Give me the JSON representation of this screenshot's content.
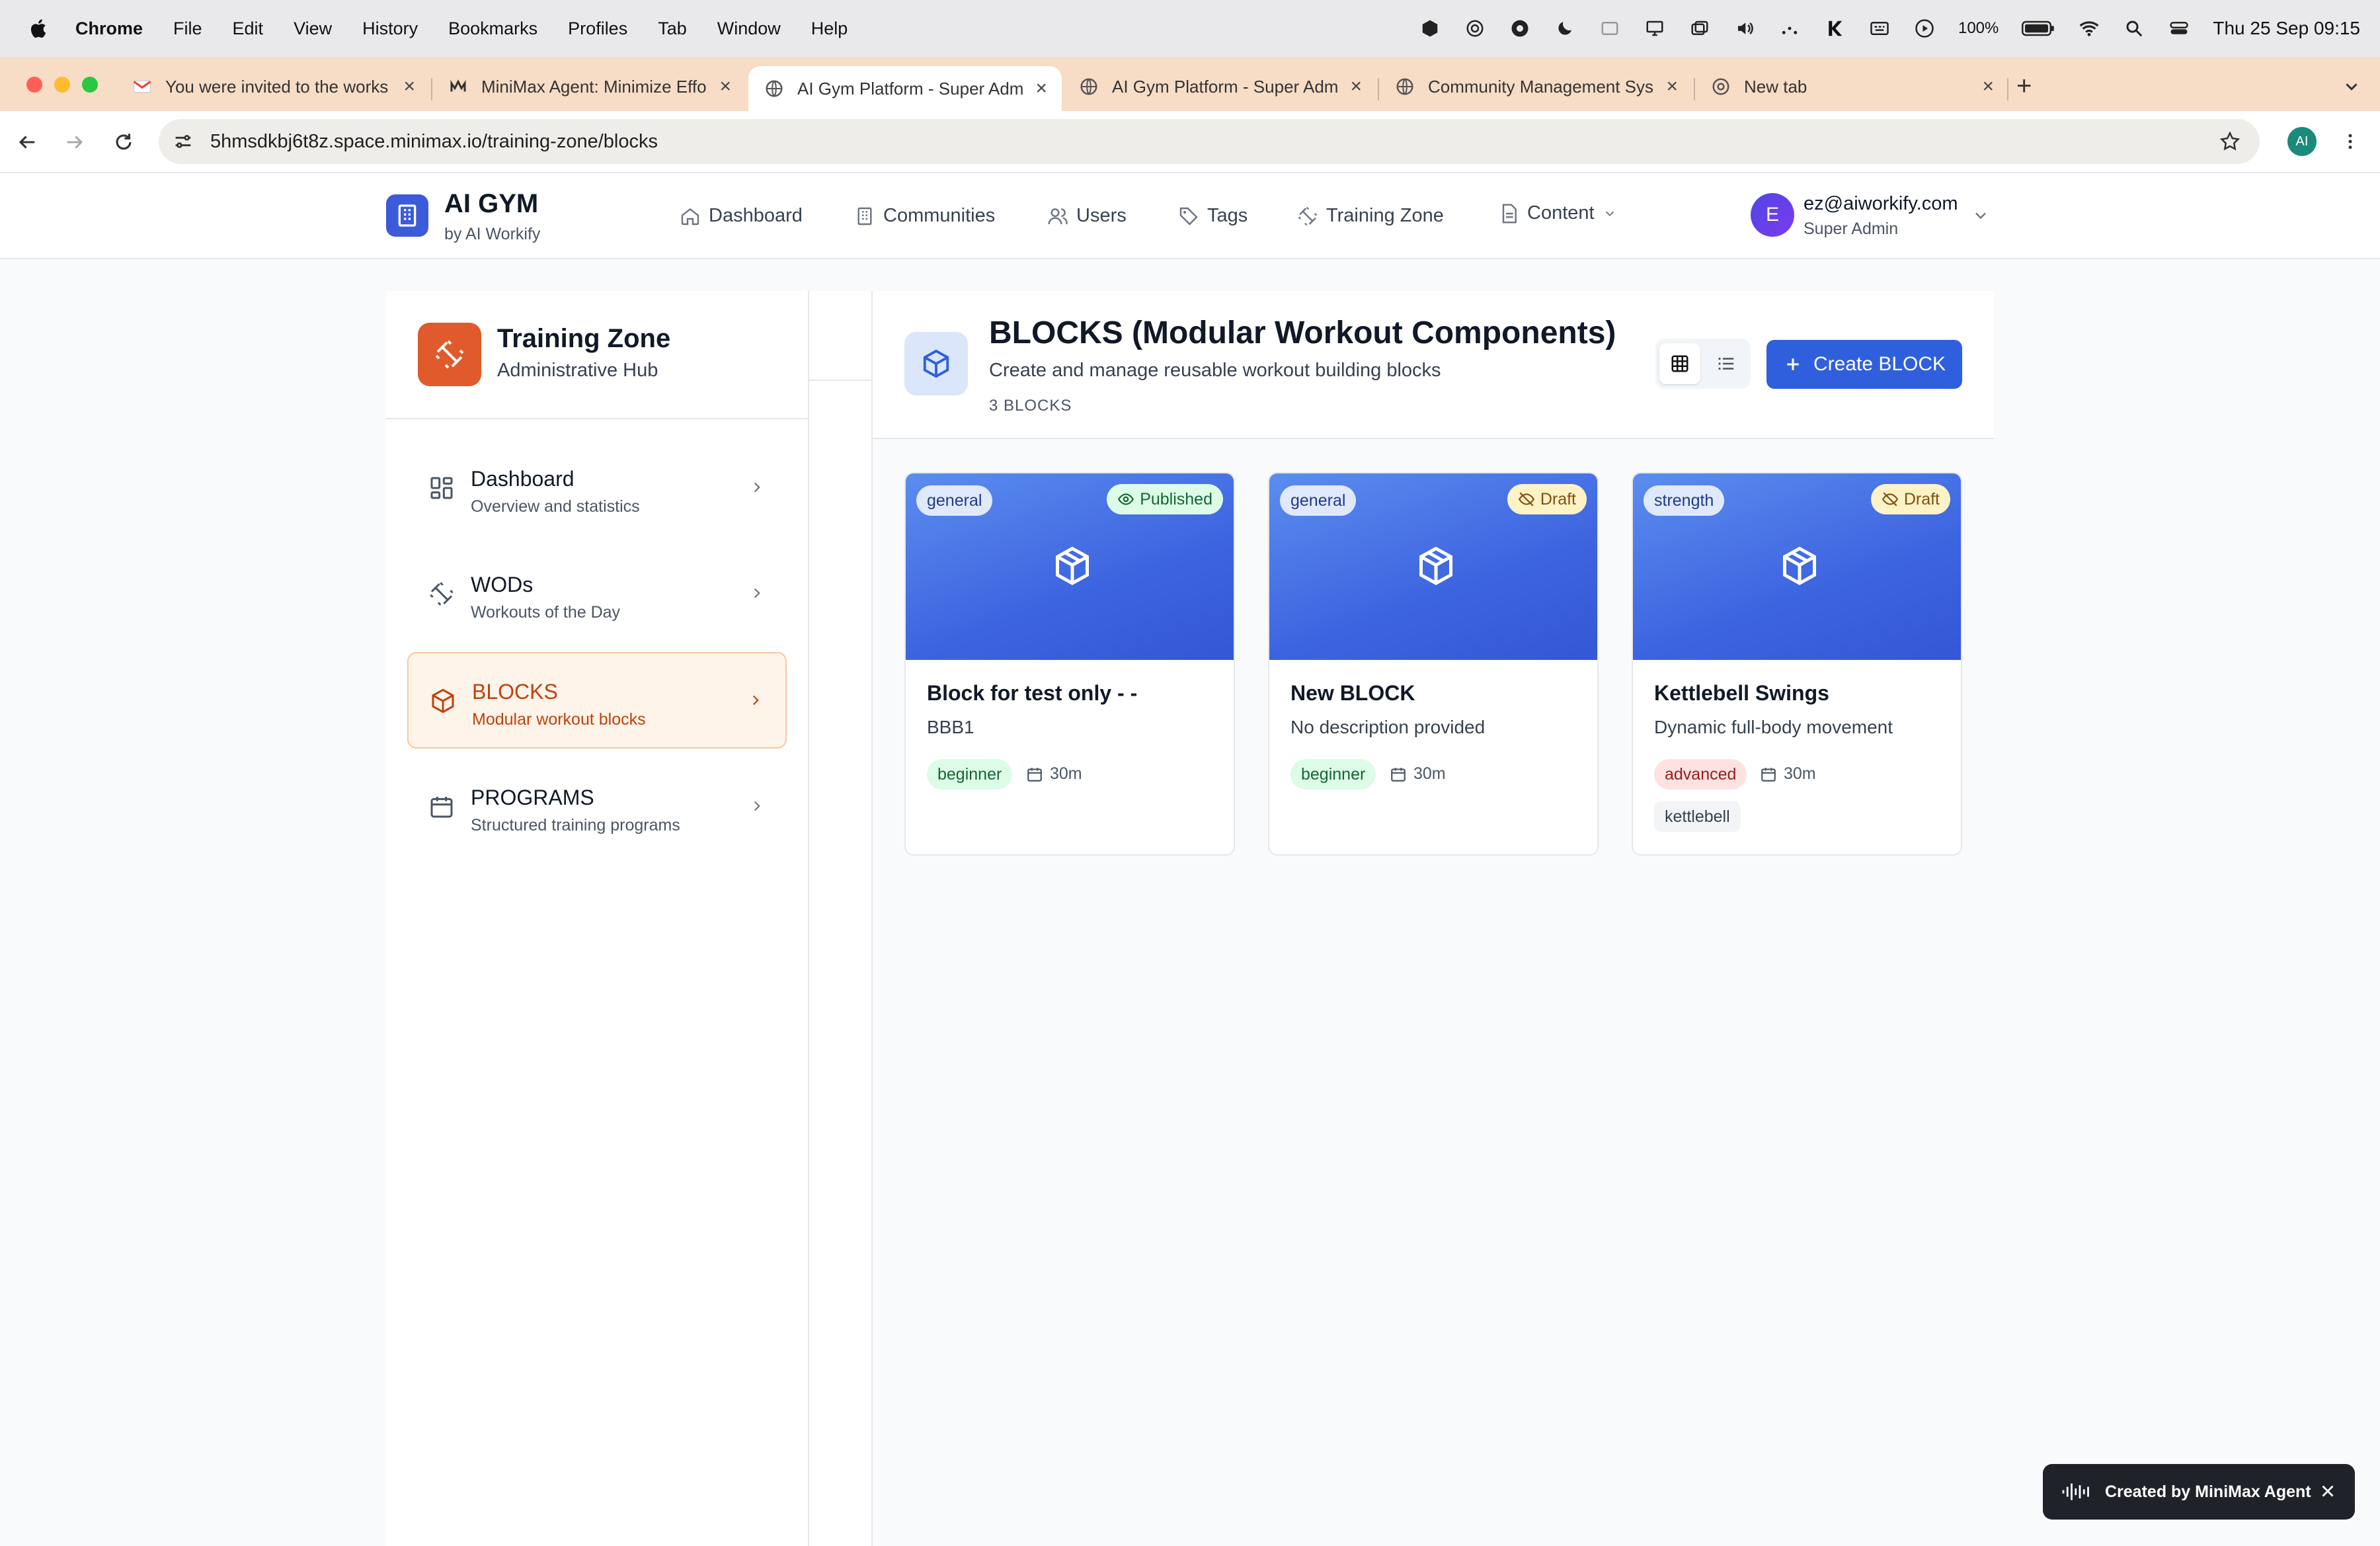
{
  "menubar": {
    "app": "Chrome",
    "items": [
      "File",
      "Edit",
      "View",
      "History",
      "Bookmarks",
      "Profiles",
      "Tab",
      "Window",
      "Help"
    ],
    "battery": "100%",
    "clock": "Thu 25 Sep  09:15"
  },
  "tabs": [
    {
      "title": "You were invited to the works",
      "icon": "gmail-icon"
    },
    {
      "title": "MiniMax Agent: Minimize Effo",
      "icon": "minimax-icon"
    },
    {
      "title": "AI Gym Platform - Super Adm",
      "icon": "globe-icon",
      "active": true
    },
    {
      "title": "AI Gym Platform - Super Adm",
      "icon": "globe-icon"
    },
    {
      "title": "Community Management Sys",
      "icon": "globe-icon"
    },
    {
      "title": "New tab",
      "icon": "chrome-icon"
    }
  ],
  "address": {
    "url": "5hmsdkbj6t8z.space.minimax.io/training-zone/blocks",
    "profile_initials": "AI"
  },
  "header": {
    "logo_title": "AI GYM",
    "logo_sub": "by AI Workify",
    "nav": [
      {
        "label": "Dashboard",
        "icon": "home-icon"
      },
      {
        "label": "Communities",
        "icon": "building-icon"
      },
      {
        "label": "Users",
        "icon": "users-icon"
      },
      {
        "label": "Tags",
        "icon": "tag-icon"
      },
      {
        "label": "Training Zone",
        "icon": "dumbbell-icon"
      },
      {
        "label": "Content",
        "icon": "document-icon"
      }
    ],
    "user_initial": "E",
    "user_email": "ez@aiworkify.com",
    "user_role": "Super Admin"
  },
  "sidebar": {
    "title": "Training Zone",
    "subtitle": "Administrative Hub",
    "items": [
      {
        "label": "Dashboard",
        "desc": "Overview and statistics",
        "icon": "grid-icon"
      },
      {
        "label": "WODs",
        "desc": "Workouts of the Day",
        "icon": "dumbbell-icon"
      },
      {
        "label": "BLOCKS",
        "desc": "Modular workout blocks",
        "icon": "cube-icon",
        "active": true
      },
      {
        "label": "PROGRAMS",
        "desc": "Structured training programs",
        "icon": "calendar-icon"
      }
    ]
  },
  "main": {
    "title": "BLOCKS (Modular Workout Components)",
    "subtitle": "Create and manage reusable workout building blocks",
    "count": "3 BLOCKS",
    "create_label": "Create BLOCK",
    "view_mode": "grid"
  },
  "cards": [
    {
      "category": "general",
      "status": "Published",
      "title": "Block for test only - -",
      "desc": "BBB1",
      "level": "beginner",
      "duration": "30m",
      "tags": []
    },
    {
      "category": "general",
      "status": "Draft",
      "title": "New BLOCK",
      "desc": "No description provided",
      "level": "beginner",
      "duration": "30m",
      "tags": []
    },
    {
      "category": "strength",
      "status": "Draft",
      "title": "Kettlebell Swings",
      "desc": "Dynamic full-body movement",
      "level": "advanced",
      "duration": "30m",
      "tags": [
        "kettlebell"
      ]
    }
  ],
  "toast": {
    "text": "Created by MiniMax Agent"
  },
  "colors": {
    "accent": "#2f5fdc",
    "training_orange": "#e05a2b",
    "active_text": "#c2410c"
  }
}
